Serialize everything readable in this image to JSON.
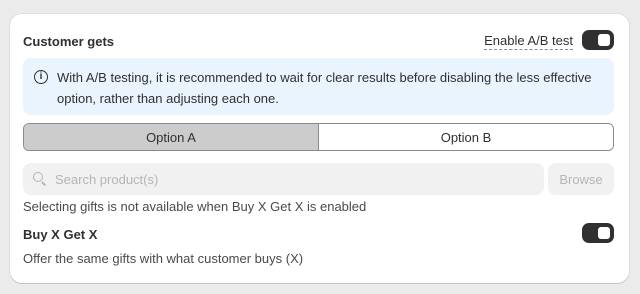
{
  "section": {
    "title": "Customer gets",
    "ab_test_label": "Enable A/B test",
    "ab_test_enabled": true
  },
  "banner": {
    "icon": "info-icon",
    "icon_glyph": "i",
    "text": "With A/B testing, it is recommended to wait for clear results before disabling the less effective option, rather than adjusting each one."
  },
  "tabs": [
    {
      "label": "Option A",
      "selected": true
    },
    {
      "label": "Option B",
      "selected": false
    }
  ],
  "search": {
    "placeholder": "Search product(s)",
    "value": "",
    "disabled": true
  },
  "browse": {
    "label": "Browse",
    "disabled": true
  },
  "helper_text": "Selecting gifts is not available when Buy X Get X is enabled",
  "buy_x_get_x": {
    "title": "Buy X Get X",
    "description": "Offer the same gifts with what customer buys (X)",
    "enabled": true
  },
  "colors": {
    "toggle_on": "#303030",
    "banner_bg": "#eaf4ff",
    "selected_tab_bg": "#cccccc"
  }
}
